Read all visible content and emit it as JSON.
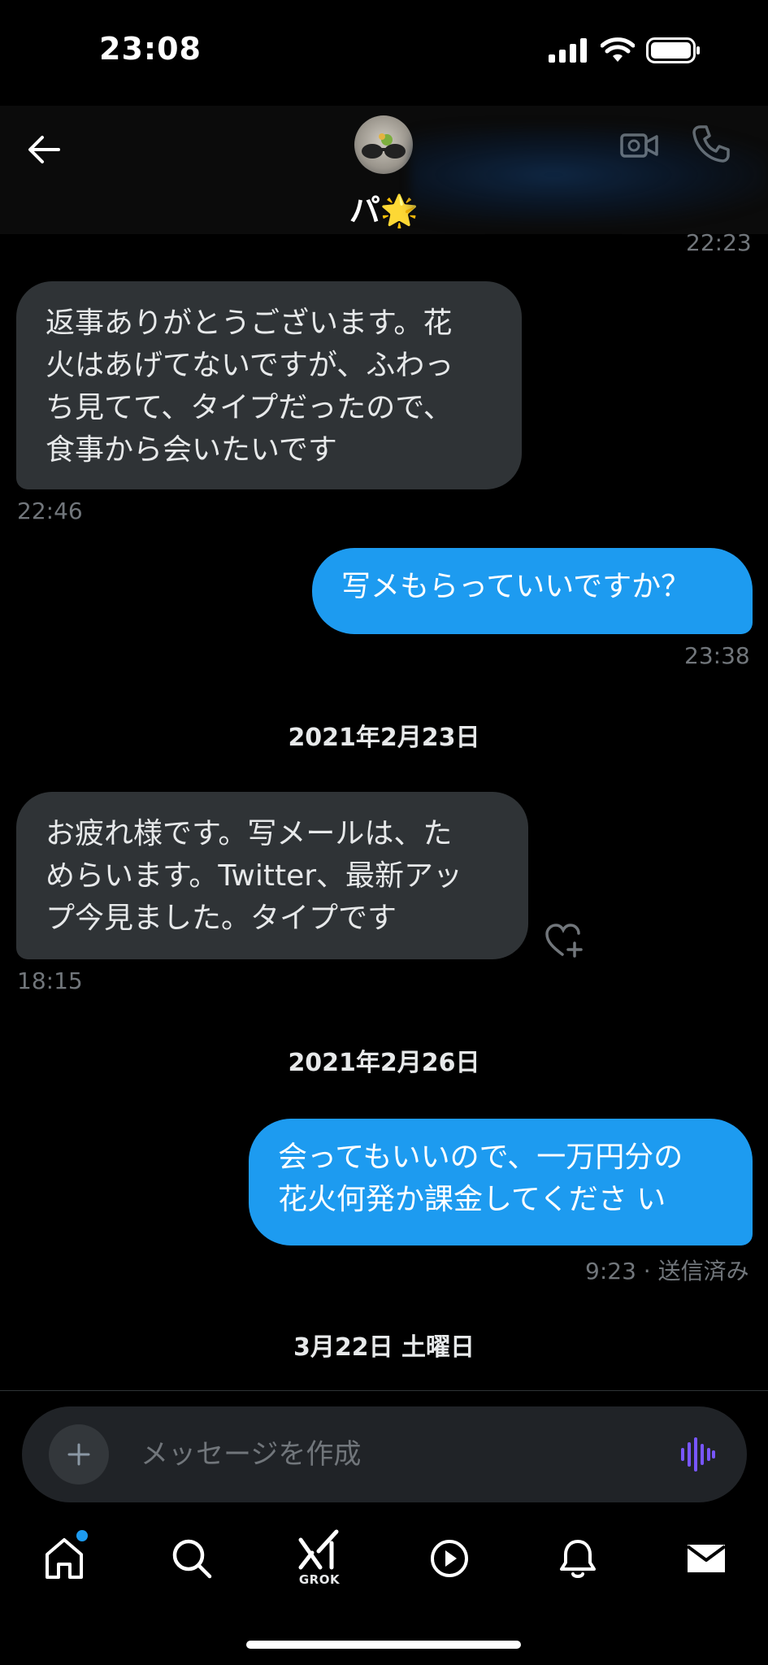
{
  "status_bar": {
    "time": "23:08"
  },
  "header": {
    "name": "パ🌟"
  },
  "messages": [
    {
      "direction": "time-only",
      "time": "22:23"
    },
    {
      "direction": "incoming",
      "lines": [
        "返事ありがとうございます。花",
        "火はあげてないですが、ふわっ",
        "ち見てて、タイプだったので、",
        "食事から会いたいです"
      ],
      "time": "22:46"
    },
    {
      "direction": "outgoing",
      "lines": [
        "写メもらっていいですか？"
      ],
      "time": "23:38"
    },
    {
      "direction": "date",
      "label": "2021年2月23日"
    },
    {
      "direction": "incoming",
      "lines": [
        "お疲れ様です。写メールは、た",
        "めらいます。Twitter、最新アッ",
        "プ今見ました。タイプです"
      ],
      "time": "18:15"
    },
    {
      "direction": "date",
      "label": "2021年2月26日"
    },
    {
      "direction": "outgoing",
      "lines": [
        "会ってもいいので、一万円分の",
        "花火何発か課金してくださ い"
      ],
      "time": "9:23 · 送信済み"
    },
    {
      "direction": "date",
      "label": "3月22日 土曜日"
    }
  ],
  "composer": {
    "placeholder": "メッセージを作成"
  },
  "tabbar": {
    "items": [
      {
        "name": "home",
        "icon": "home-icon",
        "has_badge": true
      },
      {
        "name": "search",
        "icon": "search-icon"
      },
      {
        "name": "grok",
        "icon": "grok-icon",
        "label": "GROK"
      },
      {
        "name": "video",
        "icon": "play-icon"
      },
      {
        "name": "notifications",
        "icon": "bell-icon"
      },
      {
        "name": "messages",
        "icon": "mail-icon"
      }
    ]
  },
  "colors": {
    "accent": "#1d9bf0",
    "incoming_bubble": "#2f3336",
    "background": "#000000",
    "muted_text": "#71767b",
    "voice_icon": "#7856ff"
  }
}
